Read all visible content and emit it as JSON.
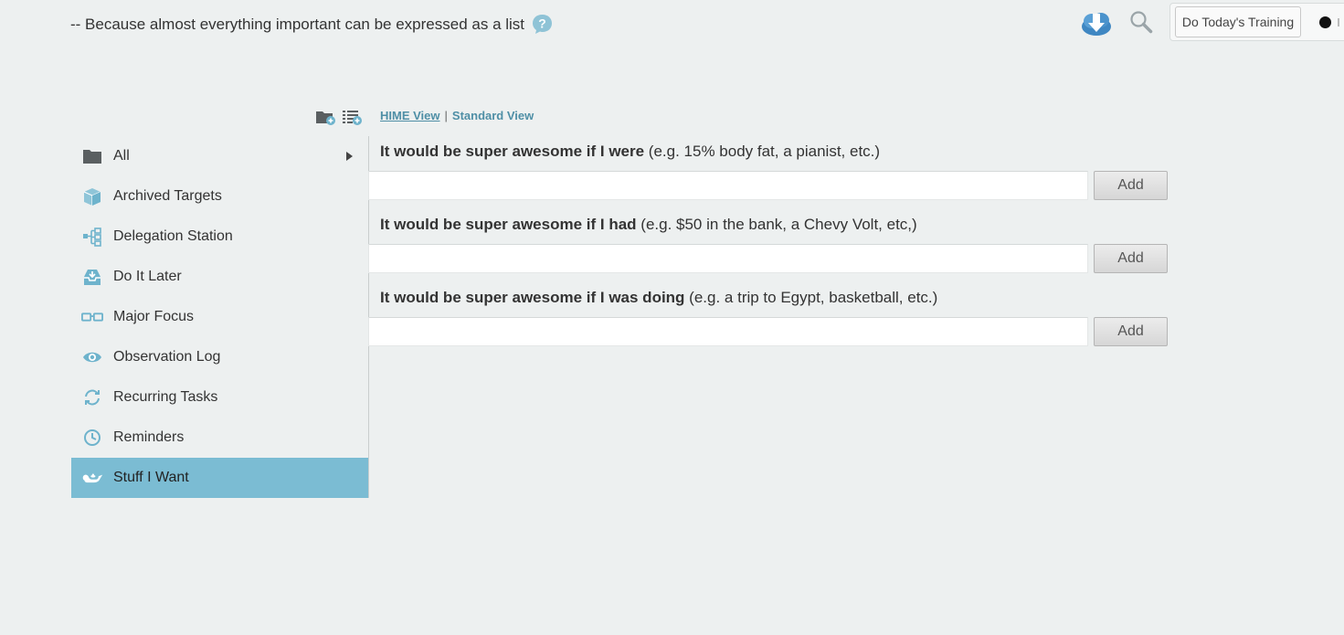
{
  "header": {
    "tagline": "-- Because almost everything important can be expressed as a list",
    "training_button": "Do Today's Training"
  },
  "icons": {
    "help": "help-icon",
    "download": "download-icon",
    "search": "search-icon",
    "new_folder": "new-folder-icon",
    "new_list": "new-list-icon"
  },
  "sidebar": {
    "items": [
      {
        "label": "All",
        "icon": "folder-icon"
      },
      {
        "label": "Archived Targets",
        "icon": "box-icon"
      },
      {
        "label": "Delegation Station",
        "icon": "org-chart-icon"
      },
      {
        "label": "Do It Later",
        "icon": "inbox-icon"
      },
      {
        "label": "Major Focus",
        "icon": "glasses-icon"
      },
      {
        "label": "Observation Log",
        "icon": "eye-icon"
      },
      {
        "label": "Recurring Tasks",
        "icon": "refresh-icon"
      },
      {
        "label": "Reminders",
        "icon": "clock-icon"
      },
      {
        "label": "Stuff I Want",
        "icon": "genie-lamp-icon"
      }
    ],
    "active_index": 8
  },
  "main": {
    "views": {
      "hime": "HIME View",
      "separator": "|",
      "standard": "Standard View"
    },
    "sections": [
      {
        "bold": "It would be super awesome if I were",
        "example": " (e.g. 15% body fat, a pianist, etc.)",
        "input_value": "",
        "add_label": "Add"
      },
      {
        "bold": "It would be super awesome if I had",
        "example": " (e.g. $50 in the bank, a Chevy Volt, etc,)",
        "input_value": "",
        "add_label": "Add"
      },
      {
        "bold": "It would be super awesome if I was doing",
        "example": " (e.g. a trip to Egypt, basketball, etc.)",
        "input_value": "",
        "add_label": "Add"
      }
    ]
  },
  "colors": {
    "background": "#edf0f0",
    "accent": "#7bbcd3",
    "icon_blue": "#6eb3cc",
    "link": "#4f8fa6"
  }
}
